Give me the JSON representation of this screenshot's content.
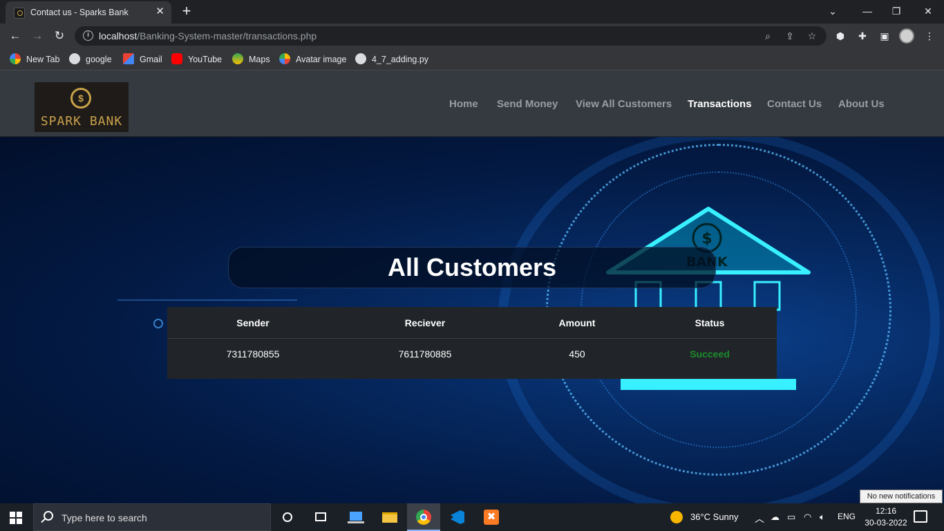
{
  "browser": {
    "tab_title": "Contact us - Sparks Bank",
    "url_host": "localhost",
    "url_path": "/Banking-System-master/transactions.php",
    "bookmarks": [
      "New Tab",
      "google",
      "Gmail",
      "YouTube",
      "Maps",
      "Avatar image",
      "4_7_adding.py"
    ]
  },
  "site": {
    "logo_text": "SPARK BANK",
    "nav": [
      "Home",
      "Send Money",
      "View All Customers",
      "Transactions",
      "Contact Us",
      "About Us"
    ],
    "active_nav": "Transactions",
    "hero_title": "All Customers",
    "hero_bank_text": "BANK"
  },
  "table": {
    "headers": [
      "Sender",
      "Reciever",
      "Amount",
      "Status"
    ],
    "rows": [
      {
        "sender": "7311780855",
        "receiver": "7611780885",
        "amount": "450",
        "status": "Succeed"
      }
    ]
  },
  "taskbar": {
    "search_placeholder": "Type here to search",
    "weather": "36°C  Sunny",
    "language": "ENG",
    "time": "12:16",
    "date": "30-03-2022",
    "notification_tooltip": "No new notifications"
  },
  "colors": {
    "accent": "#c9a24a",
    "nav_bg": "#343a40",
    "table_bg": "#212529",
    "success": "#1c8d2c"
  }
}
